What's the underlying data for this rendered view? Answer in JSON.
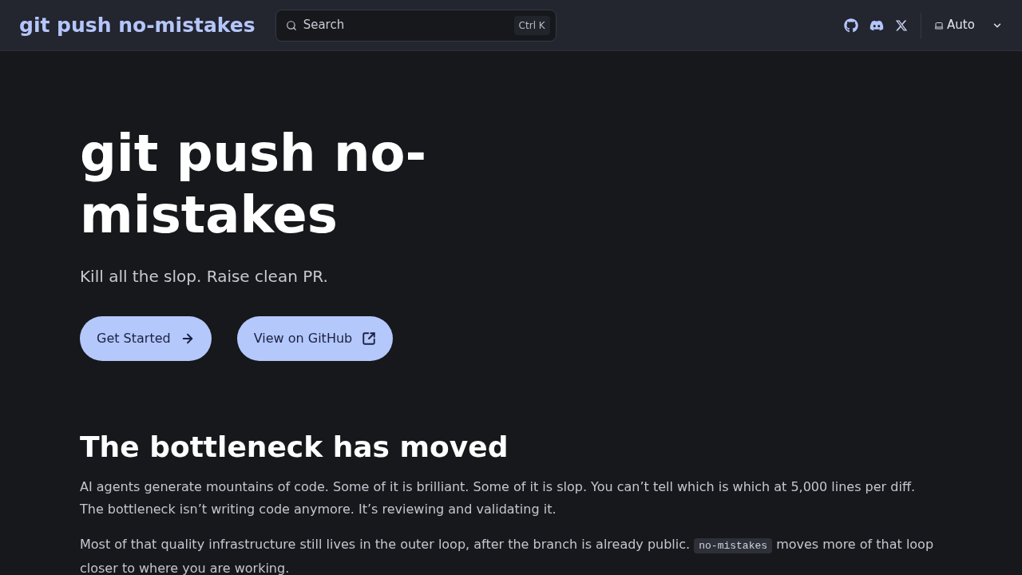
{
  "header": {
    "logo": "git push no-mistakes",
    "search": {
      "placeholder": "Search",
      "shortcut": "Ctrl K"
    },
    "social_links": [
      {
        "kind": "github"
      },
      {
        "kind": "discord"
      },
      {
        "kind": "x"
      }
    ],
    "theme_select": {
      "value": "Auto"
    }
  },
  "hero": {
    "title": "git push no-mistakes",
    "tagline": "Kill all the slop. Raise clean PR.",
    "actions": [
      {
        "label": "Get Started",
        "kind": "arrow"
      },
      {
        "label": "View on GitHub",
        "kind": "external"
      }
    ]
  },
  "section": {
    "heading": "The bottleneck has moved",
    "paragraphs": [
      {
        "parts": [
          {
            "kind": "text",
            "text": "AI agents generate mountains of code. Some of it is brilliant. Some of it is slop. You can’t tell which is which at 5,000 lines per diff. The bottleneck isn’t writing code anymore. It’s reviewing and validating it."
          }
        ]
      },
      {
        "parts": [
          {
            "kind": "text",
            "text": "Most of that quality infrastructure still lives in the outer loop, after the branch is already public. "
          },
          {
            "kind": "code",
            "text": "no-mistakes"
          },
          {
            "kind": "text",
            "text": " moves more of that loop closer to where you are working."
          }
        ]
      }
    ]
  }
}
